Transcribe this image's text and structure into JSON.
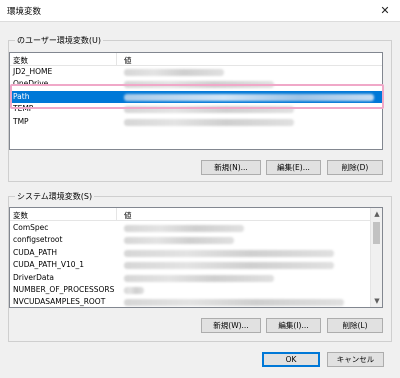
{
  "window": {
    "title": "環境変数",
    "close_glyph": "✕"
  },
  "user_section": {
    "group_label": "のユーザー環境変数(U)",
    "columns": {
      "name": "変数",
      "value": "値"
    },
    "rows": [
      {
        "name": "JD2_HOME",
        "selected": false
      },
      {
        "name": "OneDrive",
        "selected": false
      },
      {
        "name": "Path",
        "selected": true
      },
      {
        "name": "TEMP",
        "selected": false
      },
      {
        "name": "TMP",
        "selected": false
      }
    ],
    "buttons": {
      "new": "新規(N)...",
      "edit": "編集(E)...",
      "delete": "削除(D)"
    }
  },
  "system_section": {
    "group_label": "システム環境変数(S)",
    "columns": {
      "name": "変数",
      "value": "値"
    },
    "rows": [
      {
        "name": "ComSpec"
      },
      {
        "name": "configsetroot"
      },
      {
        "name": "CUDA_PATH"
      },
      {
        "name": "CUDA_PATH_V10_1"
      },
      {
        "name": "DriverData"
      },
      {
        "name": "NUMBER_OF_PROCESSORS"
      },
      {
        "name": "NVCUDASAMPLES_ROOT"
      }
    ],
    "buttons": {
      "new": "新規(W)...",
      "edit": "編集(I)...",
      "delete": "削除(L)"
    }
  },
  "footer": {
    "ok": "OK",
    "cancel": "キャンセル"
  },
  "colors": {
    "selection": "#0078d7",
    "highlight_box": "#f0a8c8",
    "window_bg": "#f0f0f0"
  },
  "icons": {
    "close": "close-icon",
    "scroll_up": "chevron-up-icon",
    "scroll_down": "chevron-down-icon"
  }
}
